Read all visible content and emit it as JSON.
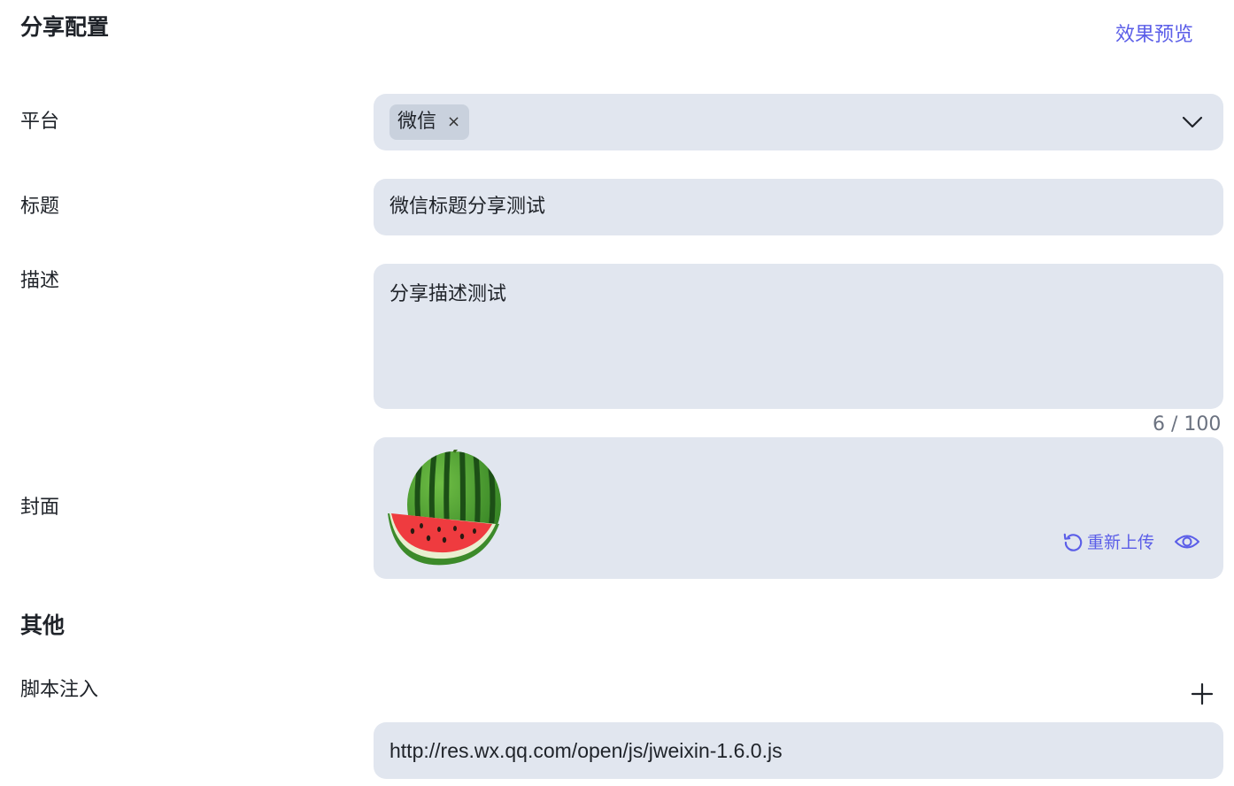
{
  "share_section": {
    "title": "分享配置",
    "preview_link": "效果预览"
  },
  "platform": {
    "label": "平台",
    "selected_tags": [
      "微信"
    ],
    "tag_close_glyph": "×",
    "dropdown_icon": "chevron-down-icon"
  },
  "title_field": {
    "label": "标题",
    "value": "微信标题分享测试"
  },
  "description_field": {
    "label": "描述",
    "value": "分享描述测试",
    "counter": "6 / 100"
  },
  "cover": {
    "label": "封面",
    "image": "watermelon-image",
    "reupload_label": "重新上传",
    "reupload_icon": "rotate-ccw-icon",
    "preview_icon": "eye-icon"
  },
  "other_section": {
    "title": "其他"
  },
  "script_injection": {
    "label": "脚本注入",
    "add_icon": "plus-icon",
    "urls": [
      "http://res.wx.qq.com/open/js/jweixin-1.6.0.js"
    ]
  },
  "colors": {
    "accent": "#5b5ee8",
    "field_background": "#e1e6ef",
    "tag_background": "#c9d1dd",
    "text": "#1f2329",
    "muted_text": "#6b7280"
  }
}
